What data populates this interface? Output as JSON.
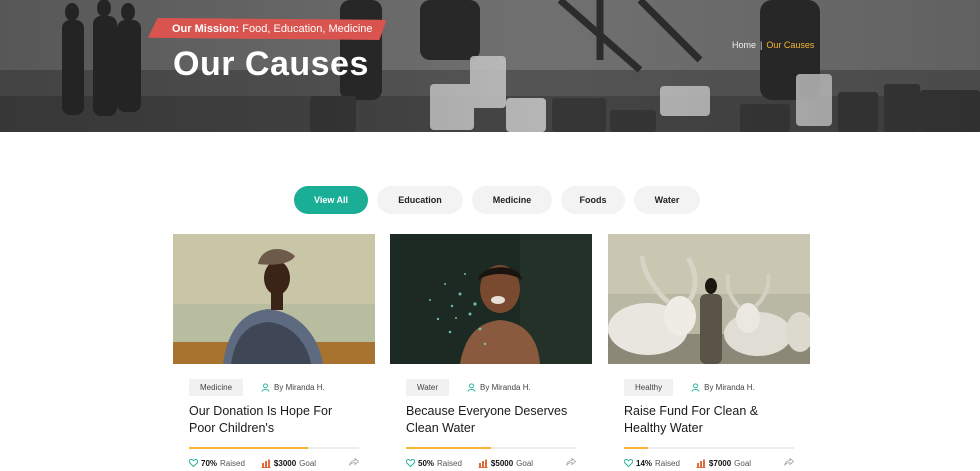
{
  "hero": {
    "mission_label": "Our Mission:",
    "mission_text": "Food, Education, Medicine",
    "title": "Our Causes",
    "breadcrumb": {
      "home": "Home",
      "separator": "|",
      "current": "Our Causes"
    }
  },
  "filters": [
    {
      "label": "View All",
      "active": true
    },
    {
      "label": "Education",
      "active": false
    },
    {
      "label": "Medicine",
      "active": false
    },
    {
      "label": "Foods",
      "active": false
    },
    {
      "label": "Water",
      "active": false
    }
  ],
  "causes": [
    {
      "tag": "Medicine",
      "author": "By Miranda H.",
      "title_line1": "Our Donation Is Hope For",
      "title_line2": "Poor Children's",
      "raised_pct": "70%",
      "raised_label": "Raised",
      "goal_amount": "$3000",
      "goal_label": "Goal",
      "progress": 0.7
    },
    {
      "tag": "Water",
      "author": "By Miranda H.",
      "title_line1": "Because Everyone Deserves",
      "title_line2": "Clean Water",
      "raised_pct": "50%",
      "raised_label": "Raised",
      "goal_amount": "$5000",
      "goal_label": "Goal",
      "progress": 0.5
    },
    {
      "tag": "Healthy",
      "author": "By Miranda H.",
      "title_line1": "Raise Fund For Clean &",
      "title_line2": "Healthy Water",
      "raised_pct": "14%",
      "raised_label": "Raised",
      "goal_amount": "$7000",
      "goal_label": "Goal",
      "progress": 0.14
    }
  ],
  "colors": {
    "accent": "#1aae96",
    "mission": "#d9534f",
    "highlight": "#f6b431",
    "goal_icon": "#e06a3a"
  },
  "icons": {
    "author": "user-icon",
    "raised": "heart-icon",
    "goal": "bar-chart-icon",
    "share": "share-icon"
  }
}
